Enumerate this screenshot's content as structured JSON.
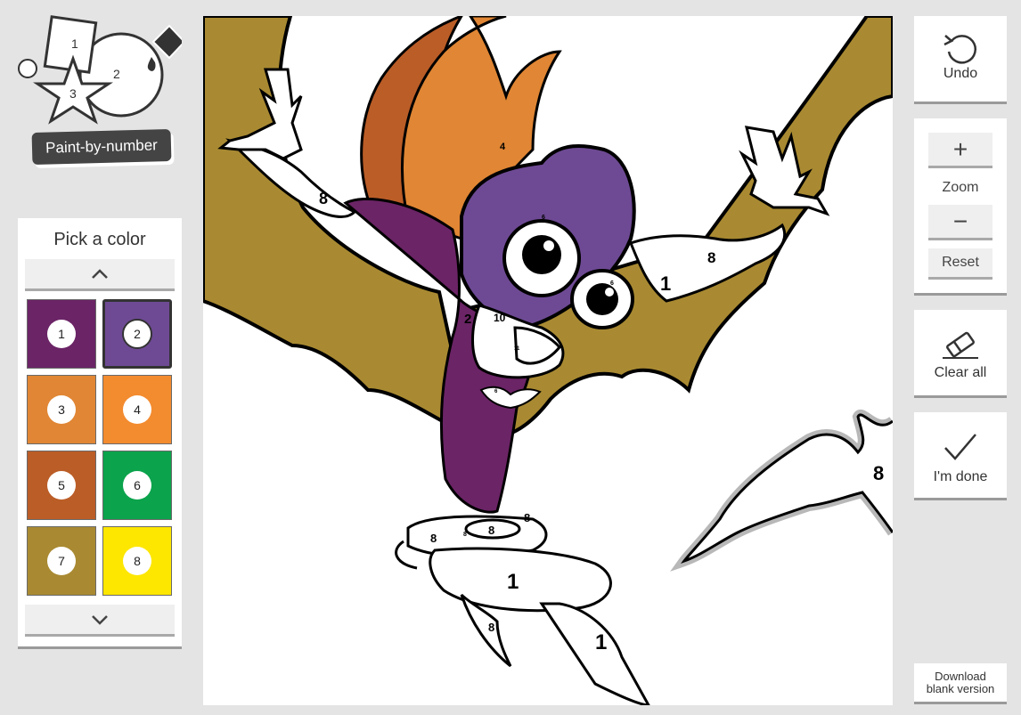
{
  "logo": {
    "label": "Paint-by-number",
    "shape_numbers": [
      "1",
      "2",
      "3"
    ]
  },
  "palette": {
    "title": "Pick a color",
    "selected": 2,
    "colors": [
      {
        "num": "1",
        "hex": "#6b2466"
      },
      {
        "num": "2",
        "hex": "#6e4a94"
      },
      {
        "num": "3",
        "hex": "#e08634"
      },
      {
        "num": "4",
        "hex": "#f38b2f"
      },
      {
        "num": "5",
        "hex": "#bb5d27"
      },
      {
        "num": "6",
        "hex": "#0ba34c"
      },
      {
        "num": "7",
        "hex": "#a98a32"
      },
      {
        "num": "8",
        "hex": "#fde600"
      }
    ]
  },
  "canvas": {
    "region_numbers": [
      "8",
      "4",
      "8",
      "1",
      "2",
      "10",
      "6",
      "6",
      "11",
      "6",
      "8",
      "8",
      "8",
      "8",
      "1",
      "8",
      "1",
      "8"
    ],
    "colors": {
      "wing": "#a98a32",
      "hair_orange": "#e08634",
      "hair_dark": "#bb5d27",
      "mask": "#6e4a94",
      "body": "#6b2466",
      "outline": "#000000",
      "bat_outline": "#9a9a9a"
    }
  },
  "tools": {
    "undo": "Undo",
    "zoom": "Zoom",
    "zoom_in_symbol": "+",
    "zoom_out_symbol": "−",
    "reset": "Reset",
    "clear_all": "Clear all",
    "done": "I'm done",
    "download_line1": "Download",
    "download_line2": "blank version"
  }
}
